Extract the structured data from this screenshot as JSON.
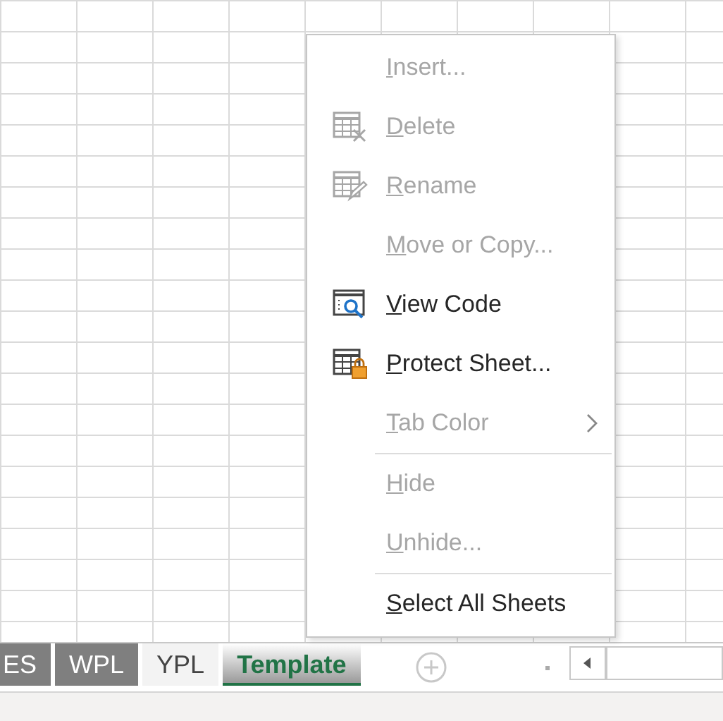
{
  "sheet_tabs": [
    {
      "label": "ES",
      "selected": false,
      "color": "#7f7f7f"
    },
    {
      "label": "WPL",
      "selected": false,
      "color": "#7f7f7f"
    },
    {
      "label": "YPL",
      "selected": false
    },
    {
      "label": "Template",
      "selected": true
    }
  ],
  "context_menu": {
    "items": [
      {
        "label": "Insert...",
        "disabled": true
      },
      {
        "label": "Delete",
        "disabled": true,
        "kind": "delete"
      },
      {
        "label": "Rename",
        "disabled": true,
        "kind": "rename"
      },
      {
        "label": "Move or Copy...",
        "disabled": true
      },
      {
        "label": "View Code",
        "disabled": false,
        "kind": "code"
      },
      {
        "label": "Protect Sheet...",
        "disabled": false,
        "kind": "protect"
      },
      {
        "label": "Tab Color",
        "disabled": true,
        "submenu": true
      },
      {
        "label": "Hide",
        "disabled": true,
        "separator_before": true
      },
      {
        "label": "Unhide...",
        "disabled": true
      },
      {
        "label": "Select All Sheets",
        "disabled": false,
        "separator_before": true
      }
    ]
  }
}
